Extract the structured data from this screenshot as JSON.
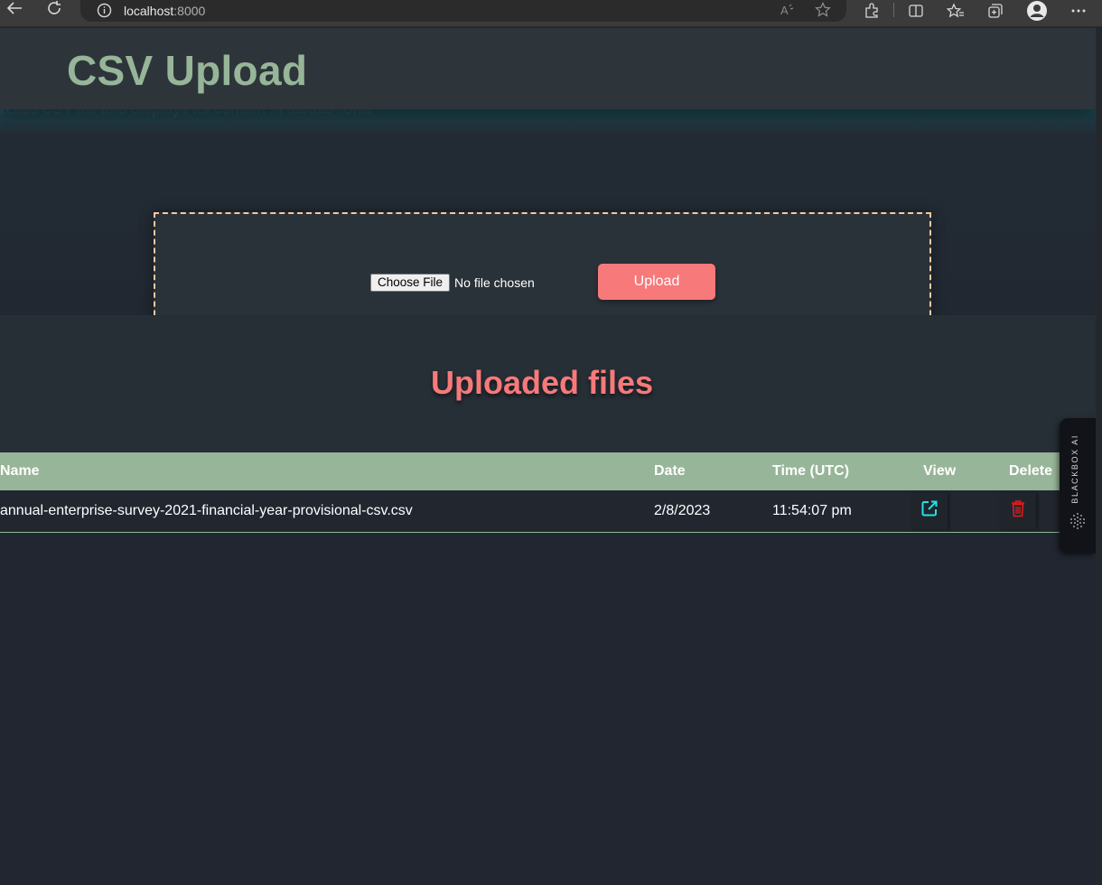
{
  "browser": {
    "url_host": "localhost",
    "url_port": ":8000"
  },
  "header": {
    "title": "CSV Upload"
  },
  "hero": {
    "description": "reads CSV file and displays its content in tabular form"
  },
  "upload": {
    "choose_label": "Choose File",
    "file_status": "No file chosen",
    "button_label": "Upload"
  },
  "files": {
    "heading": "Uploaded files",
    "columns": [
      "Name",
      "Date",
      "Time (UTC)",
      "View",
      "Delete"
    ],
    "rows": [
      {
        "name": "annual-enterprise-survey-2021-financial-year-provisional-csv.csv",
        "date": "2/8/2023",
        "time": "11:54:07 pm"
      }
    ]
  },
  "widget": {
    "label": "BLACKBOX AI"
  },
  "colors": {
    "title": "#97b598",
    "accent": "#f7797a",
    "table_header": "#97b598",
    "view_icon": "#26e0e6",
    "delete_icon": "#e01c1c",
    "dropzone_border": "#f3c9a3"
  }
}
